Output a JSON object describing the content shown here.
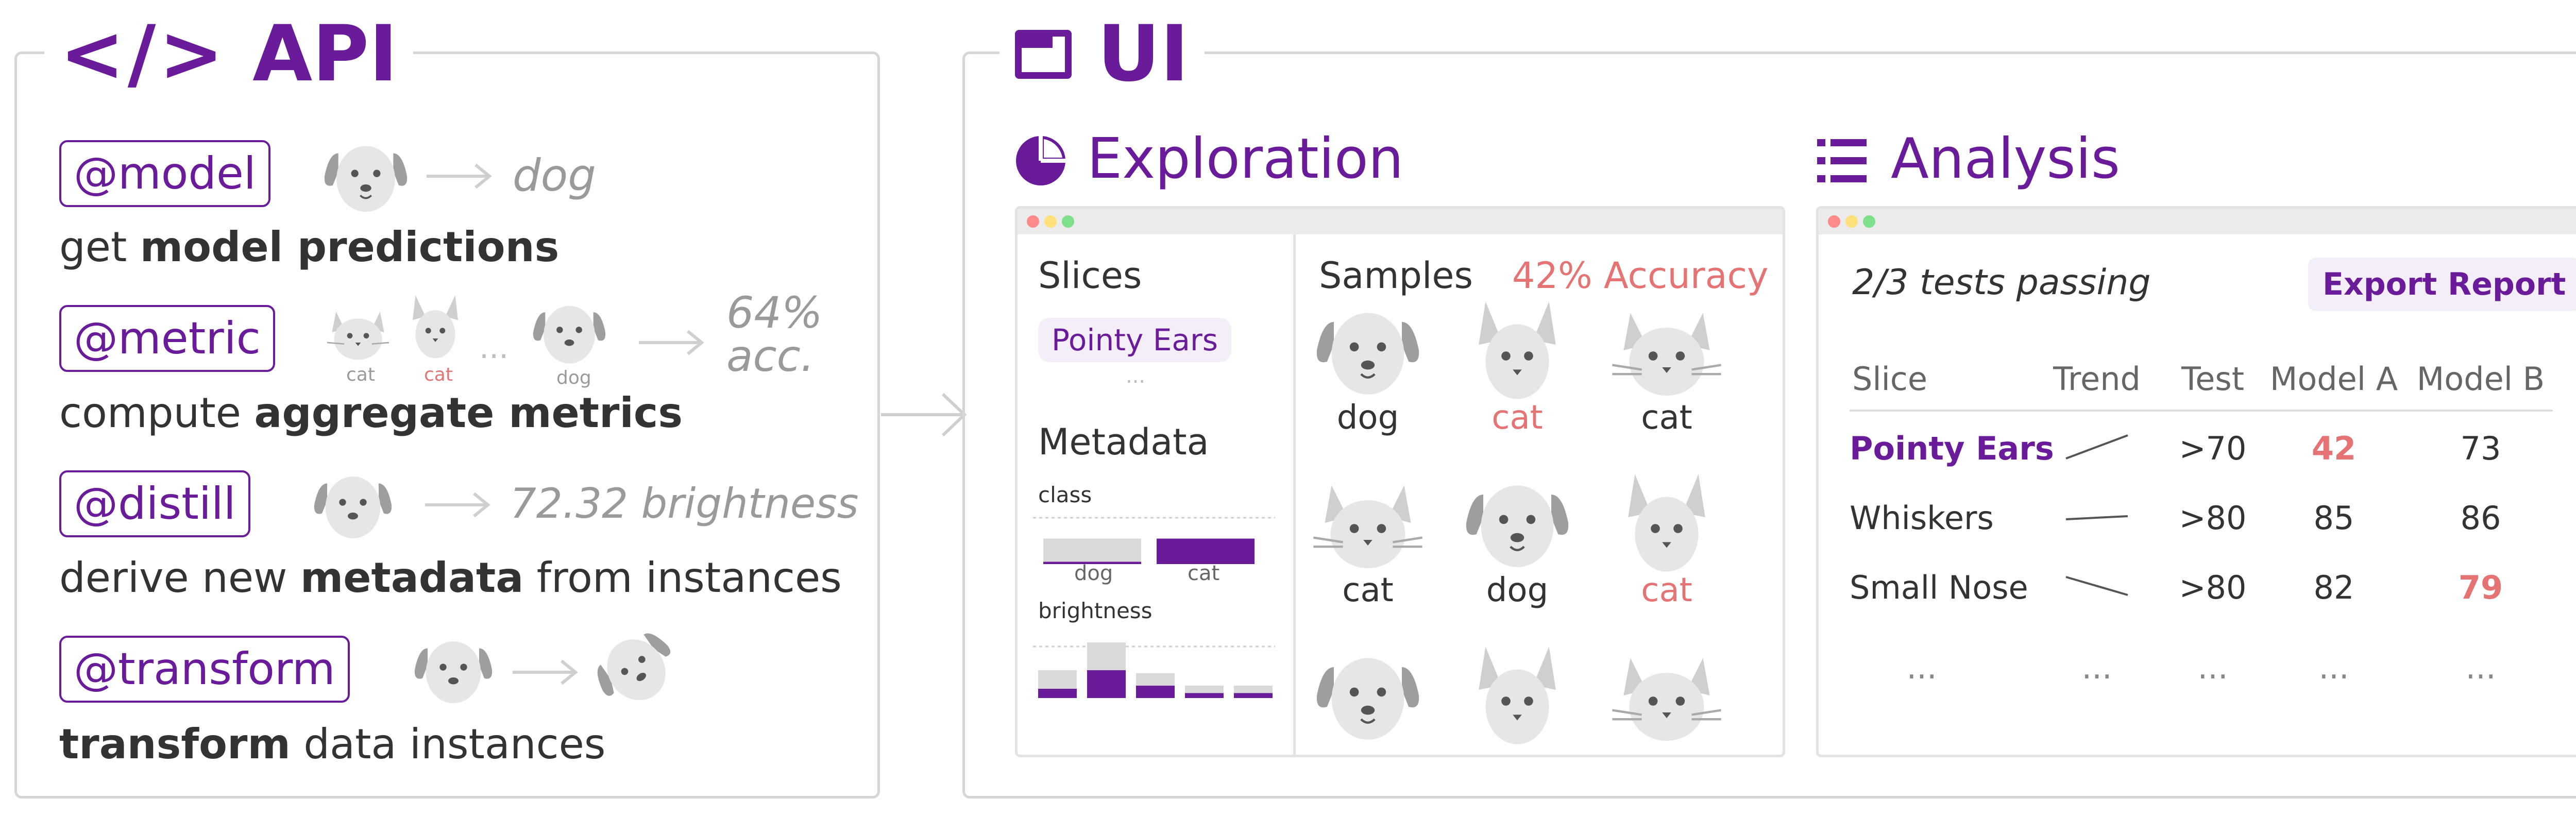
{
  "api": {
    "title": "API",
    "title_glyph": "</>",
    "items": [
      {
        "decorator": "@model",
        "desc_plain_1": "get ",
        "desc_bold": "model predictions",
        "desc_plain_2": "",
        "output": "dog"
      },
      {
        "decorator": "@metric",
        "desc_plain_1": "compute ",
        "desc_bold": "aggregate metrics",
        "desc_plain_2": "",
        "output": "64%\nacc.",
        "thumb_labels": [
          "cat",
          "cat",
          "dog"
        ],
        "ellipsis": "..."
      },
      {
        "decorator": "@distill",
        "desc_plain_1": "derive new ",
        "desc_bold": "metadata",
        "desc_plain_2": " from instances",
        "output": "72.32 brightness"
      },
      {
        "decorator": "@transform",
        "desc_plain_1": "",
        "desc_bold": "transform",
        "desc_plain_2": " data instances",
        "output": ""
      }
    ]
  },
  "ui": {
    "title": "UI",
    "exploration": {
      "title": "Exploration",
      "slices_title": "Slices",
      "slice_chip": "Pointy Ears",
      "slices_more": "...",
      "metadata_title": "Metadata",
      "class_label": "class",
      "class_categories": [
        "dog",
        "cat"
      ],
      "class_values": [
        0.55,
        0.55
      ],
      "class_highlight": [
        0.05,
        0.55
      ],
      "brightness_label": "brightness",
      "brightness_values": [
        0.45,
        0.9,
        0.4,
        0.2,
        0.2
      ],
      "brightness_highlight": [
        0.15,
        0.45,
        0.2,
        0.08,
        0.08
      ],
      "samples_title": "Samples",
      "accuracy": "42% Accuracy",
      "sample_labels": [
        "dog",
        "cat",
        "cat",
        "cat",
        "dog",
        "cat"
      ],
      "sample_label_errors": [
        false,
        true,
        false,
        false,
        false,
        true
      ]
    },
    "analysis": {
      "title": "Analysis",
      "tests_passing": "2/3 tests passing",
      "export_button": "Export Report",
      "columns": [
        "Slice",
        "Trend",
        "Test",
        "Model A",
        "Model B"
      ],
      "rows": [
        {
          "slice": "Pointy Ears",
          "trend": "up",
          "test": ">70",
          "model_a": "42",
          "model_b": "73",
          "a_fail": true,
          "b_fail": false,
          "highlight": true
        },
        {
          "slice": "Whiskers",
          "trend": "flat",
          "test": ">80",
          "model_a": "85",
          "model_b": "86",
          "a_fail": false,
          "b_fail": false,
          "highlight": false
        },
        {
          "slice": "Small Nose",
          "trend": "down",
          "test": ">80",
          "model_a": "82",
          "model_b": "79",
          "a_fail": false,
          "b_fail": true,
          "highlight": false
        }
      ],
      "ellipsis": "..."
    }
  },
  "colors": {
    "accent": "#6a1b9a",
    "error": "#e57373",
    "muted": "#9a9a9a",
    "border": "#d6d6d6",
    "chip_bg": "#f3eef8",
    "bar_gray": "#d9d9d9"
  }
}
